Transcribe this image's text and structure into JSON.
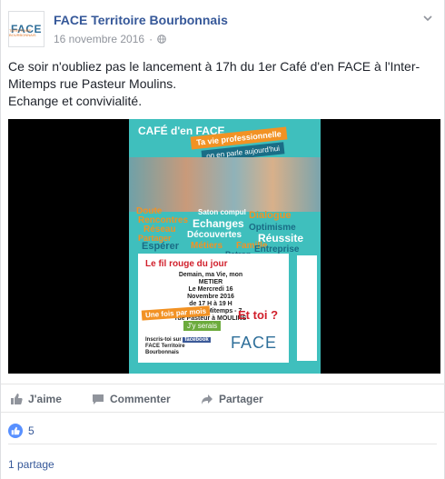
{
  "post": {
    "page_name": "FACE Territoire Bourbonnais",
    "date": "16 novembre 2016",
    "privacy_icon": "globe-icon",
    "text_lines": [
      "Ce soir n'oubliez pas le lancement à 17h du 1er Café d'en FACE à l'Inter-",
      "Mitemps rue Pasteur Moulins.",
      "Echange et convivialité."
    ]
  },
  "avatar": {
    "logo": "FACE",
    "tag": "TERRITOIRE BOURBONNAIS"
  },
  "poster": {
    "title": "CAFÉ d'en FACE",
    "badge1": "Ta vie professionnelle",
    "badge2": "on en parle aujourd'hui",
    "words": [
      {
        "text": "Doute",
        "color": "#f29224"
      },
      {
        "text": "Rencontres",
        "color": "#f29224"
      },
      {
        "text": "Réseau",
        "color": "#f29224"
      },
      {
        "text": "Partager",
        "color": "#f29224"
      },
      {
        "text": "Espérer",
        "color": "#1a6d86"
      },
      {
        "text": "Echanges",
        "color": "#ffffff"
      },
      {
        "text": "Découvertes",
        "color": "#ffffff"
      },
      {
        "text": "Métiers",
        "color": "#f29224"
      },
      {
        "text": "Famille",
        "color": "#f29224"
      },
      {
        "text": "Patron",
        "color": "#1a6d86"
      },
      {
        "text": "Dialogue",
        "color": "#f29224"
      },
      {
        "text": "Optimisme",
        "color": "#1a6d86"
      },
      {
        "text": "Réussite",
        "color": "#ffffff"
      },
      {
        "text": "Entreprise",
        "color": "#1a6d86"
      },
      {
        "text": "Saton compul",
        "color": "#ffffff"
      }
    ],
    "fil_rouge": "Le fil rouge du jour",
    "demain": "Demain, ma Vie, mon METIER",
    "date_line": "Le Mercredi 16 Novembre 2016",
    "time_line": "de 17 H à 19 H",
    "place_line": "A L'Inter-Mitemps - 7 rue Pasteur à MOULINS",
    "once": "Une fois par mois",
    "jy": "J'y serais",
    "ettoi": "Et toi ?",
    "inscris": "Inscris-toi sur",
    "facebook": "facebook",
    "inscris_page": "FACE Territoire Bourbonnais",
    "logo": "FACE"
  },
  "actions": {
    "like": "J'aime",
    "comment": "Commenter",
    "share": "Partager"
  },
  "stats": {
    "likes": "5",
    "shares": "1 partage"
  },
  "colors": {
    "link": "#365899",
    "poster_bg": "#3fbfbd",
    "orange": "#f29224",
    "red": "#d11f2b"
  }
}
